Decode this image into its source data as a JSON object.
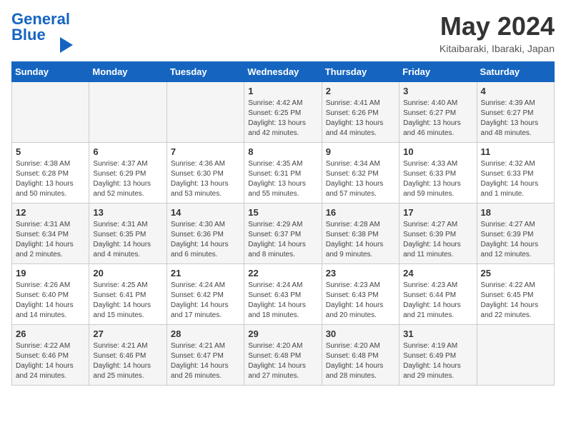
{
  "header": {
    "logo_line1": "General",
    "logo_line2": "Blue",
    "month_year": "May 2024",
    "location": "Kitaibaraki, Ibaraki, Japan"
  },
  "days_of_week": [
    "Sunday",
    "Monday",
    "Tuesday",
    "Wednesday",
    "Thursday",
    "Friday",
    "Saturday"
  ],
  "weeks": [
    [
      {
        "day": "",
        "info": ""
      },
      {
        "day": "",
        "info": ""
      },
      {
        "day": "",
        "info": ""
      },
      {
        "day": "1",
        "info": "Sunrise: 4:42 AM\nSunset: 6:25 PM\nDaylight: 13 hours\nand 42 minutes."
      },
      {
        "day": "2",
        "info": "Sunrise: 4:41 AM\nSunset: 6:26 PM\nDaylight: 13 hours\nand 44 minutes."
      },
      {
        "day": "3",
        "info": "Sunrise: 4:40 AM\nSunset: 6:27 PM\nDaylight: 13 hours\nand 46 minutes."
      },
      {
        "day": "4",
        "info": "Sunrise: 4:39 AM\nSunset: 6:27 PM\nDaylight: 13 hours\nand 48 minutes."
      }
    ],
    [
      {
        "day": "5",
        "info": "Sunrise: 4:38 AM\nSunset: 6:28 PM\nDaylight: 13 hours\nand 50 minutes."
      },
      {
        "day": "6",
        "info": "Sunrise: 4:37 AM\nSunset: 6:29 PM\nDaylight: 13 hours\nand 52 minutes."
      },
      {
        "day": "7",
        "info": "Sunrise: 4:36 AM\nSunset: 6:30 PM\nDaylight: 13 hours\nand 53 minutes."
      },
      {
        "day": "8",
        "info": "Sunrise: 4:35 AM\nSunset: 6:31 PM\nDaylight: 13 hours\nand 55 minutes."
      },
      {
        "day": "9",
        "info": "Sunrise: 4:34 AM\nSunset: 6:32 PM\nDaylight: 13 hours\nand 57 minutes."
      },
      {
        "day": "10",
        "info": "Sunrise: 4:33 AM\nSunset: 6:33 PM\nDaylight: 13 hours\nand 59 minutes."
      },
      {
        "day": "11",
        "info": "Sunrise: 4:32 AM\nSunset: 6:33 PM\nDaylight: 14 hours\nand 1 minute."
      }
    ],
    [
      {
        "day": "12",
        "info": "Sunrise: 4:31 AM\nSunset: 6:34 PM\nDaylight: 14 hours\nand 2 minutes."
      },
      {
        "day": "13",
        "info": "Sunrise: 4:31 AM\nSunset: 6:35 PM\nDaylight: 14 hours\nand 4 minutes."
      },
      {
        "day": "14",
        "info": "Sunrise: 4:30 AM\nSunset: 6:36 PM\nDaylight: 14 hours\nand 6 minutes."
      },
      {
        "day": "15",
        "info": "Sunrise: 4:29 AM\nSunset: 6:37 PM\nDaylight: 14 hours\nand 8 minutes."
      },
      {
        "day": "16",
        "info": "Sunrise: 4:28 AM\nSunset: 6:38 PM\nDaylight: 14 hours\nand 9 minutes."
      },
      {
        "day": "17",
        "info": "Sunrise: 4:27 AM\nSunset: 6:39 PM\nDaylight: 14 hours\nand 11 minutes."
      },
      {
        "day": "18",
        "info": "Sunrise: 4:27 AM\nSunset: 6:39 PM\nDaylight: 14 hours\nand 12 minutes."
      }
    ],
    [
      {
        "day": "19",
        "info": "Sunrise: 4:26 AM\nSunset: 6:40 PM\nDaylight: 14 hours\nand 14 minutes."
      },
      {
        "day": "20",
        "info": "Sunrise: 4:25 AM\nSunset: 6:41 PM\nDaylight: 14 hours\nand 15 minutes."
      },
      {
        "day": "21",
        "info": "Sunrise: 4:24 AM\nSunset: 6:42 PM\nDaylight: 14 hours\nand 17 minutes."
      },
      {
        "day": "22",
        "info": "Sunrise: 4:24 AM\nSunset: 6:43 PM\nDaylight: 14 hours\nand 18 minutes."
      },
      {
        "day": "23",
        "info": "Sunrise: 4:23 AM\nSunset: 6:43 PM\nDaylight: 14 hours\nand 20 minutes."
      },
      {
        "day": "24",
        "info": "Sunrise: 4:23 AM\nSunset: 6:44 PM\nDaylight: 14 hours\nand 21 minutes."
      },
      {
        "day": "25",
        "info": "Sunrise: 4:22 AM\nSunset: 6:45 PM\nDaylight: 14 hours\nand 22 minutes."
      }
    ],
    [
      {
        "day": "26",
        "info": "Sunrise: 4:22 AM\nSunset: 6:46 PM\nDaylight: 14 hours\nand 24 minutes."
      },
      {
        "day": "27",
        "info": "Sunrise: 4:21 AM\nSunset: 6:46 PM\nDaylight: 14 hours\nand 25 minutes."
      },
      {
        "day": "28",
        "info": "Sunrise: 4:21 AM\nSunset: 6:47 PM\nDaylight: 14 hours\nand 26 minutes."
      },
      {
        "day": "29",
        "info": "Sunrise: 4:20 AM\nSunset: 6:48 PM\nDaylight: 14 hours\nand 27 minutes."
      },
      {
        "day": "30",
        "info": "Sunrise: 4:20 AM\nSunset: 6:48 PM\nDaylight: 14 hours\nand 28 minutes."
      },
      {
        "day": "31",
        "info": "Sunrise: 4:19 AM\nSunset: 6:49 PM\nDaylight: 14 hours\nand 29 minutes."
      },
      {
        "day": "",
        "info": ""
      }
    ]
  ]
}
